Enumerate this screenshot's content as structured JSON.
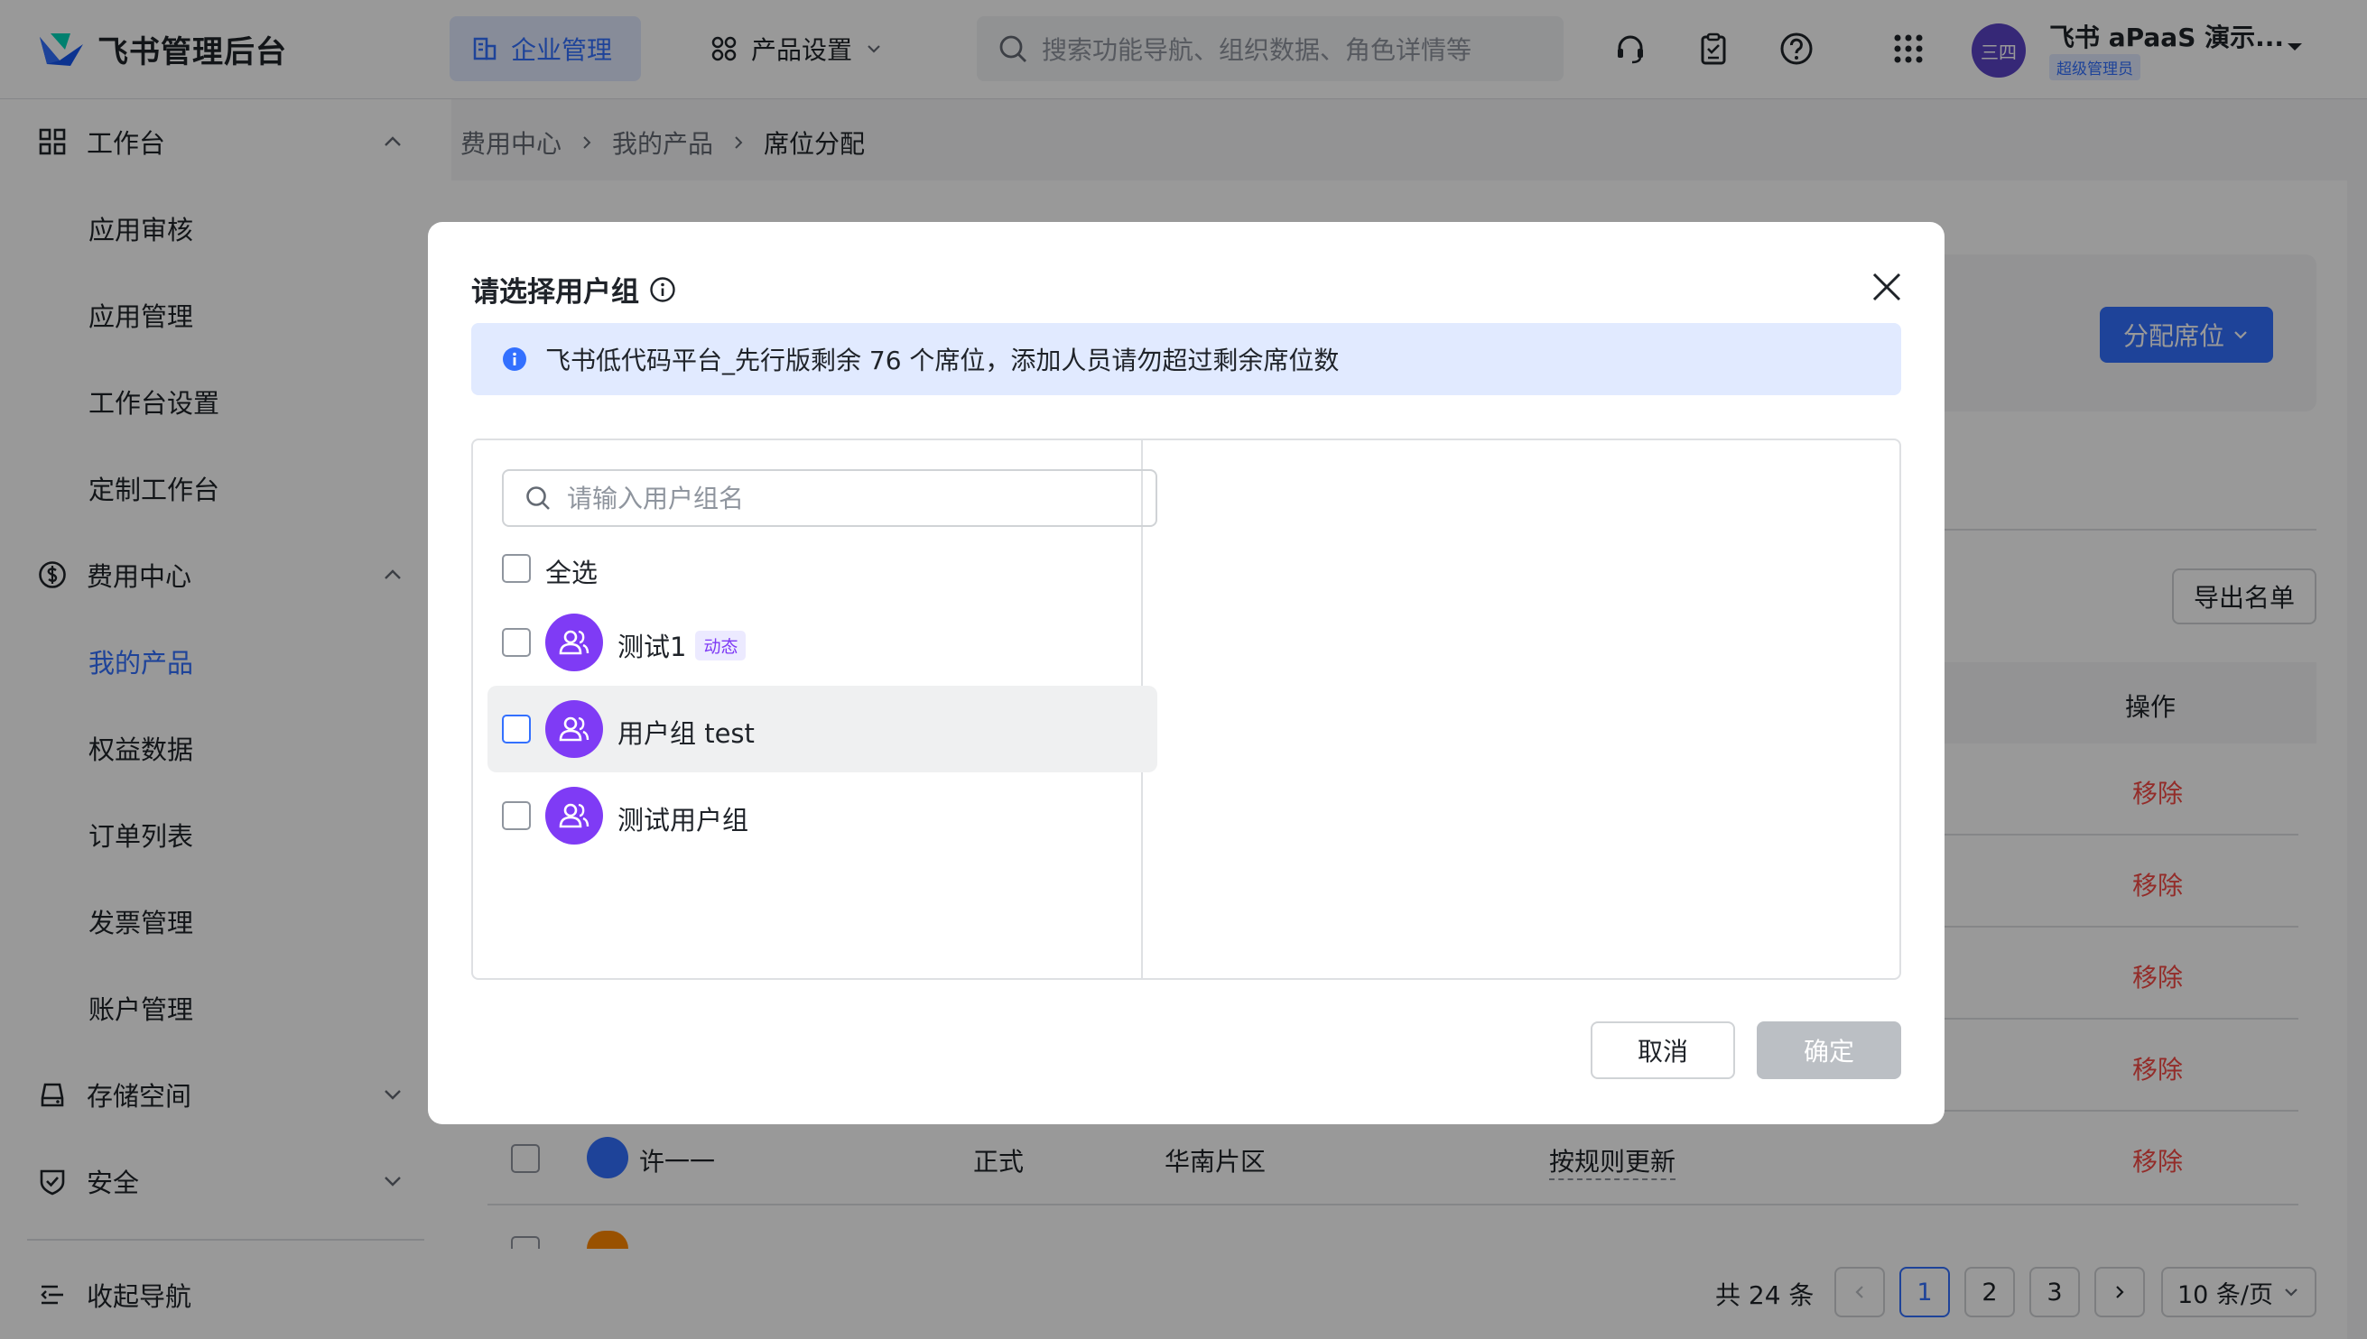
{
  "app": {
    "title": "飞书管理后台",
    "nav": {
      "enterprise": "企业管理",
      "product_settings": "产品设置"
    },
    "search_placeholder": "搜索功能导航、组织数据、角色详情等",
    "user": {
      "avatar": "三四",
      "name": "飞书 aPaaS 演示...",
      "badge": "超级管理员"
    }
  },
  "sidebar": {
    "workbench": "工作台",
    "workbench_items": [
      "应用审核",
      "应用管理",
      "工作台设置",
      "定制工作台"
    ],
    "billing": "费用中心",
    "billing_items": [
      "我的产品",
      "权益数据",
      "订单列表",
      "发票管理",
      "账户管理"
    ],
    "storage": "存储空间",
    "security": "安全",
    "collapse": "收起导航"
  },
  "breadcrumb": [
    "费用中心",
    "我的产品",
    "席位分配"
  ],
  "page": {
    "assign_button": "分配席位",
    "export_button": "导出名单",
    "col_action": "操作",
    "remove_label": "移除",
    "row": {
      "name": "许一一",
      "type": "正式",
      "region": "华南片区",
      "rule": "按规则更新"
    }
  },
  "pagination": {
    "total": "共 24 条",
    "pages": [
      "1",
      "2",
      "3"
    ],
    "current": "1",
    "page_size": "10 条/页"
  },
  "modal": {
    "title": "请选择用户组",
    "notice": "飞书低代码平台_先行版剩余 76 个席位，添加人员请勿超过剩余席位数",
    "search_placeholder": "请输入用户组名",
    "select_all": "全选",
    "groups": [
      {
        "name": "测试1",
        "tag": "动态"
      },
      {
        "name": "用户组 test"
      },
      {
        "name": "测试用户组"
      }
    ],
    "cancel": "取消",
    "confirm": "确定"
  },
  "colors": {
    "primary": "#3370ff",
    "danger": "#f54a45",
    "group_avatar": "#7f3bf5"
  }
}
